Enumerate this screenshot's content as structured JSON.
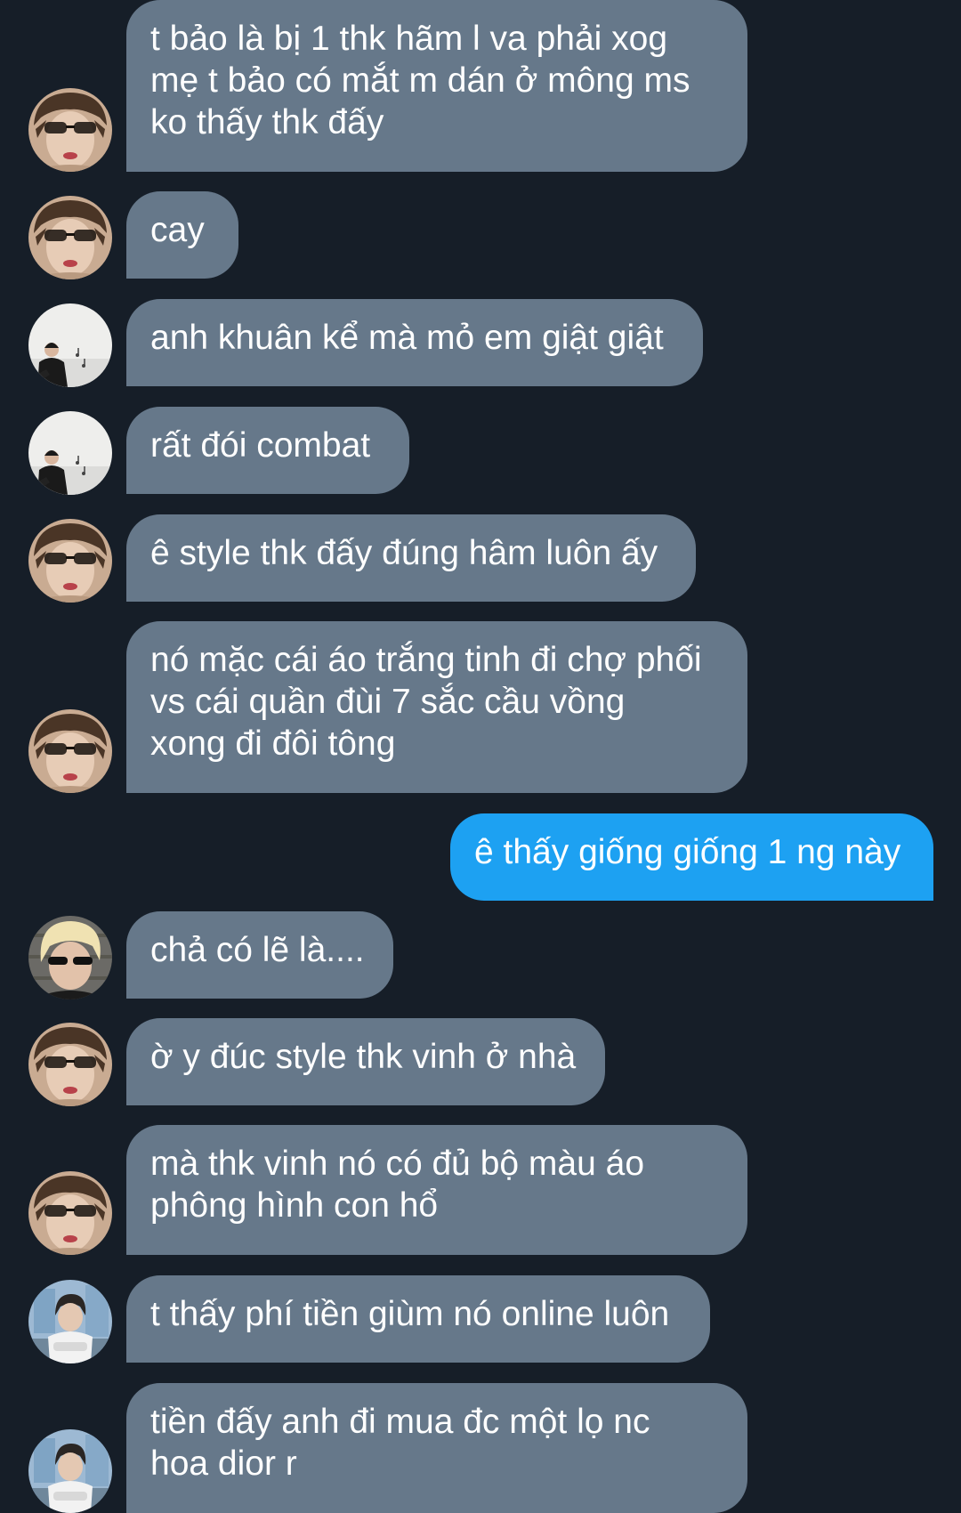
{
  "conversation": {
    "messages": [
      {
        "sender": "avatar-glasses",
        "text": "t bảo là bị 1 thk hãm l va phải xog\nmẹ t bảo có mắt m dán ở mông ms\nko thấy thk đấy"
      },
      {
        "sender": "avatar-glasses",
        "text": "cay"
      },
      {
        "sender": "avatar-studio",
        "text": "anh khuân kể mà mỏ em giật giật"
      },
      {
        "sender": "avatar-studio",
        "text": "rất đói combat"
      },
      {
        "sender": "avatar-glasses",
        "text": "ê style thk đấy đúng hâm luôn ấy"
      },
      {
        "sender": "avatar-glasses",
        "text": "nó mặc cái áo trắng tinh đi chợ phối\nvs cái quần đùi 7 sắc cầu vồng\nxong đi đôi tông"
      },
      {
        "sender": "self",
        "text": "ê thấy giống giống 1 ng này"
      },
      {
        "sender": "avatar-blonde",
        "text": "chả có lẽ là...."
      },
      {
        "sender": "avatar-glasses",
        "text": "ờ y đúc style thk vinh ở nhà"
      },
      {
        "sender": "avatar-glasses",
        "text": "mà thk vinh nó có đủ bộ màu áo\nphông hình con hổ"
      },
      {
        "sender": "avatar-window",
        "text": "t thấy phí tiền giùm nó online luôn"
      },
      {
        "sender": "avatar-window",
        "text": "tiền đấy anh đi mua đc một lọ nc\nhoa dior r"
      }
    ]
  },
  "colors": {
    "background": "#161e28",
    "incoming_bubble": "#66788a",
    "outgoing_bubble": "#1da1f2",
    "text": "#ffffff"
  }
}
